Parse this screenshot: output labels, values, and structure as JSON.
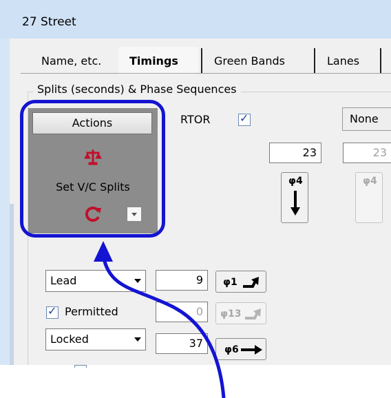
{
  "window": {
    "title": "27 Street"
  },
  "tabs": [
    {
      "label": "Name, etc."
    },
    {
      "label": "Timings"
    },
    {
      "label": "Green Bands"
    },
    {
      "label": "Lanes"
    }
  ],
  "group": {
    "label": "Splits (seconds) & Phase Sequences"
  },
  "actions": {
    "button_label": "Actions",
    "set_label": "Set V/C Splits",
    "scale_icon": "scale-icon",
    "refresh_icon": "refresh-icon"
  },
  "rtor": {
    "label": "RTOR",
    "checked": true
  },
  "none_button": {
    "label": "None"
  },
  "phase_top": [
    {
      "value": "23",
      "phase": "φ4"
    },
    {
      "value": "23",
      "phase": "φ4"
    }
  ],
  "rows": [
    {
      "select": "Lead",
      "value": "9",
      "phase": "φ1"
    },
    {
      "checkbox_label": "Permitted",
      "checked": true,
      "value": "0",
      "phase": "φ13"
    },
    {
      "select": "Locked",
      "value": "37",
      "phase": "φ6"
    }
  ],
  "colors": {
    "highlight": "#1414d2",
    "accent_red": "#c0102a"
  }
}
